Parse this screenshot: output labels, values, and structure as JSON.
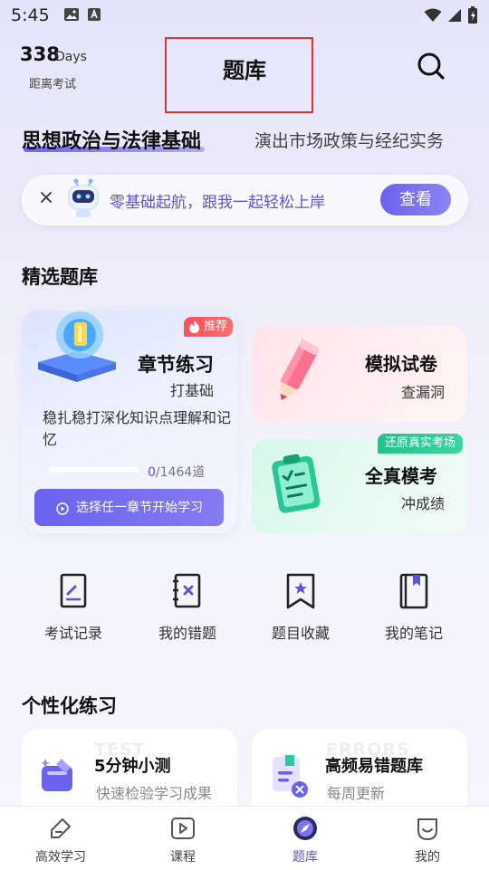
{
  "status_bar": {
    "time": "5:45"
  },
  "header": {
    "days_number": "338",
    "days_unit": "Days",
    "days_label": "距离考试",
    "title": "题库"
  },
  "subject_tabs": [
    {
      "label": "思想政治与法律基础",
      "active": true
    },
    {
      "label": "演出市场政策与经纪实务",
      "active": false
    }
  ],
  "banner": {
    "text": "零基础起航，跟我一起轻松上岸",
    "button": "查看"
  },
  "featured": {
    "section_title": "精选题库",
    "chapter": {
      "badge": "推荐",
      "title": "章节练习",
      "subtitle": "打基础",
      "description": "稳扎稳打深化知识点理解和记忆",
      "progress_done": "0",
      "progress_total": "/1464道",
      "progress_fraction": 0,
      "button": "选择任一章节开始学习"
    },
    "mock": {
      "title": "模拟试卷",
      "subtitle": "查漏洞"
    },
    "real": {
      "badge": "还原真实考场",
      "title": "全真模考",
      "subtitle": "冲成绩"
    }
  },
  "quick_actions": [
    {
      "label": "考试记录",
      "icon": "exam-record-icon"
    },
    {
      "label": "我的错题",
      "icon": "wrong-questions-icon"
    },
    {
      "label": "题目收藏",
      "icon": "bookmark-icon"
    },
    {
      "label": "我的笔记",
      "icon": "notes-icon"
    }
  ],
  "personalized": {
    "section_title": "个性化练习",
    "cards": [
      {
        "bg_text": "TEST",
        "title": "5分钟小测",
        "subtitle": "快速检验学习成果",
        "icon": "quick-test-icon"
      },
      {
        "bg_text": "ERRORS",
        "title": "高频易错题库",
        "subtitle": "每周更新",
        "icon": "frequent-errors-icon"
      }
    ]
  },
  "bottom_nav": [
    {
      "label": "高效学习",
      "icon": "study-icon",
      "active": false
    },
    {
      "label": "课程",
      "icon": "course-icon",
      "active": false
    },
    {
      "label": "题库",
      "icon": "question-bank-icon",
      "active": true
    },
    {
      "label": "我的",
      "icon": "profile-icon",
      "active": false
    }
  ],
  "colors": {
    "accent": "#6a62ee",
    "hot": "#ff4e5b",
    "real": "#21c38b"
  }
}
